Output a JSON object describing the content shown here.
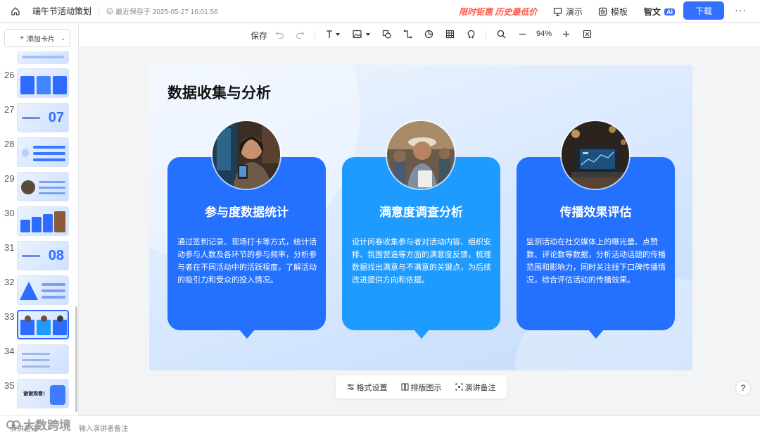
{
  "header": {
    "doc_title": "端午节活动策划",
    "saved_status": "最近保存于 2025-05-27 16:01:56",
    "promo_a": "限时钜惠",
    "promo_b": "历史最低价",
    "present_label": "演示",
    "template_label": "模板",
    "ai_label": "智文",
    "ai_badge": "AI",
    "download_label": "下载",
    "more_label": "···"
  },
  "toolbar": {
    "save_label": "保存",
    "zoom": "94%"
  },
  "sidebar": {
    "add_card_label": "添加卡片",
    "thumbnails": [
      {
        "num": "26"
      },
      {
        "num": "27",
        "big": "07"
      },
      {
        "num": "28"
      },
      {
        "num": "29"
      },
      {
        "num": "30"
      },
      {
        "num": "31",
        "big": "08"
      },
      {
        "num": "32"
      },
      {
        "num": "33"
      },
      {
        "num": "34"
      },
      {
        "num": "35",
        "caption": "谢谢观看！"
      }
    ]
  },
  "slide": {
    "title": "数据收集与分析",
    "cards": [
      {
        "heading": "参与度数据统计",
        "body": "通过签到记录、现场打卡等方式，统计活动参与人数及各环节的参与频率，分析参与者在不同活动中的活跃程度，了解活动的吸引力和受众的投入情况。",
        "color": "#2470ff"
      },
      {
        "heading": "满意度调查分析",
        "body": "设计问卷收集参与者对活动内容、组织安排、氛围营造等方面的满意度反馈，梳理数据找出满意与不满意的关键点，为后续改进提供方向和依据。",
        "color": "#1e9bff"
      },
      {
        "heading": "传播效果评估",
        "body": "监测活动在社交媒体上的曝光量、点赞数、评论数等数据，分析活动话题的传播范围和影响力，同时关注线下口碑传播情况，综合评估活动的传播效果。",
        "color": "#2470ff"
      }
    ]
  },
  "float_bar": {
    "format_label": "格式设置",
    "layout_label": "排版图示",
    "notes_label": "演讲备注"
  },
  "help_label": "?",
  "notes": {
    "label": "演讲备注",
    "placeholder": "输入演讲者备注"
  },
  "watermark": "大数跨境"
}
